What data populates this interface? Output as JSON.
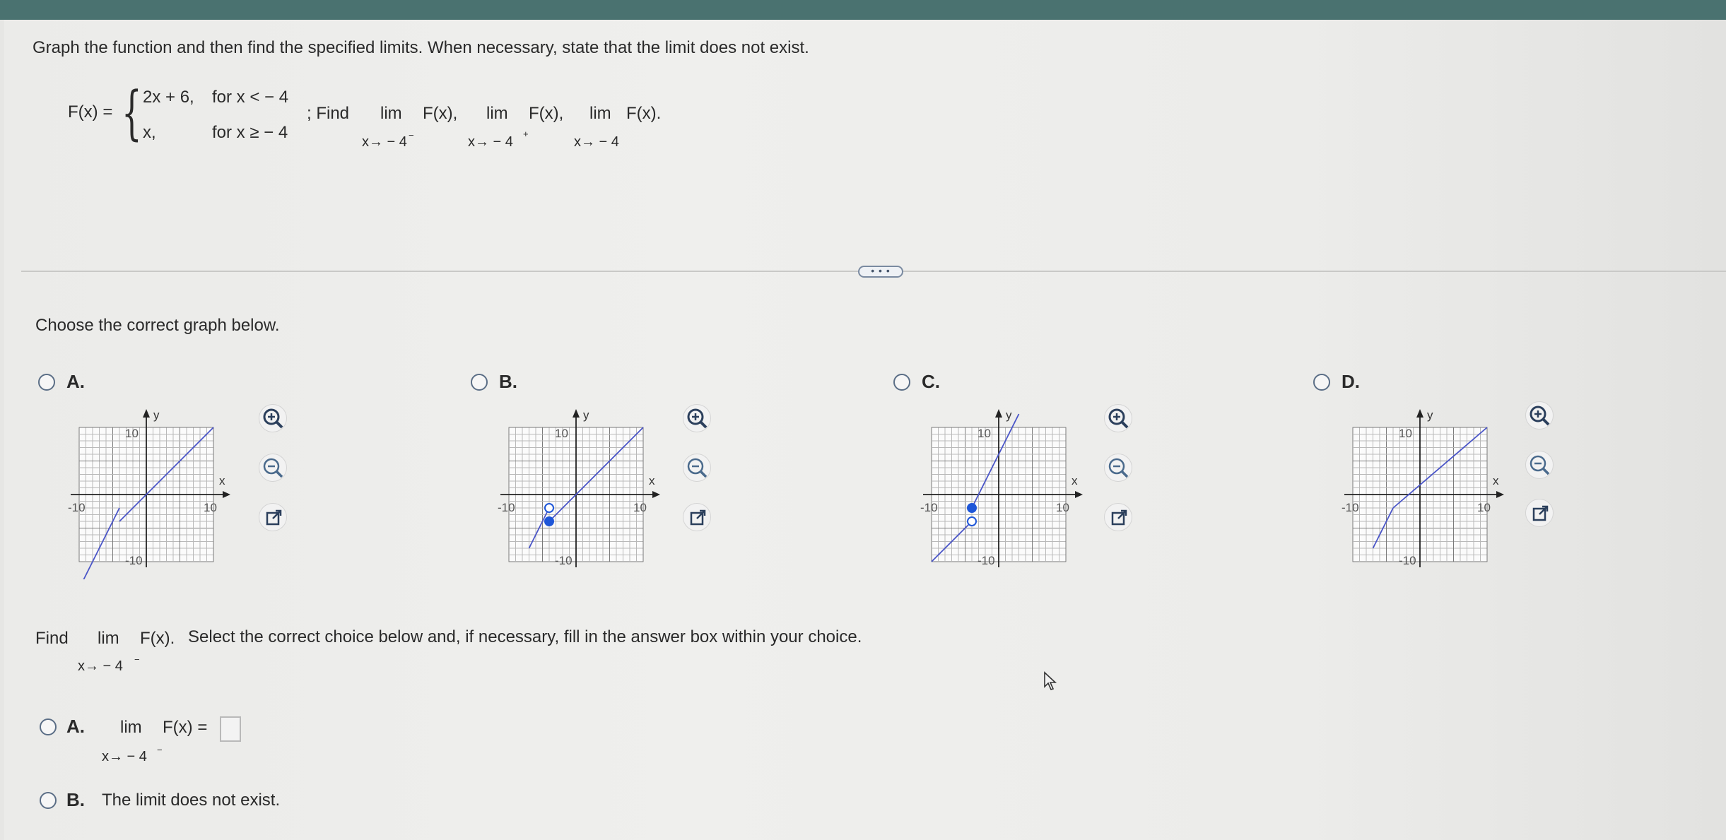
{
  "question": {
    "instruction": "Graph the function and then find the specified limits. When necessary, state that the limit does not exist.",
    "function_name": "F(x) =",
    "piece1_expr": "2x + 6,",
    "piece1_cond": "for x < − 4",
    "piece2_expr": "x,",
    "piece2_cond": "for x ≥ − 4",
    "find_label": "; Find",
    "lim_word": "lim",
    "limits": [
      {
        "expr": "F(x),",
        "sub": "x→ − 4",
        "sup": "−"
      },
      {
        "expr": "F(x),",
        "sub": "x→ − 4",
        "sup": "+"
      },
      {
        "expr": "F(x).",
        "sub": "x→ − 4",
        "sup": ""
      }
    ]
  },
  "more_button": "• • •",
  "graph_prompt": "Choose the correct graph below.",
  "graph_choices": [
    {
      "letter": "A.",
      "pieces": [
        [
          [
            -10,
            -14
          ],
          [
            -4,
            -2
          ]
        ],
        [
          [
            -4,
            -4
          ],
          [
            10,
            10
          ]
        ]
      ],
      "dots": []
    },
    {
      "letter": "B.",
      "pieces": [
        [
          [
            -7,
            -8
          ],
          [
            -4,
            -2
          ]
        ],
        [
          [
            -4,
            -4
          ],
          [
            10,
            10
          ]
        ]
      ],
      "dots": [
        {
          "x": -4,
          "y": -2,
          "filled": false
        },
        {
          "x": -4,
          "y": -4,
          "filled": true
        }
      ]
    },
    {
      "letter": "C.",
      "pieces": [
        [
          [
            -10,
            -10
          ],
          [
            -4,
            -4
          ]
        ],
        [
          [
            -4,
            -2
          ],
          [
            3,
            12
          ]
        ]
      ],
      "dots": [
        {
          "x": -4,
          "y": -2,
          "filled": true
        },
        {
          "x": -4,
          "y": -4,
          "filled": false
        }
      ]
    },
    {
      "letter": "D.",
      "pieces": [
        [
          [
            -7,
            -8
          ],
          [
            -4,
            -2
          ]
        ],
        [
          [
            -4,
            -2
          ],
          [
            10,
            10
          ]
        ]
      ],
      "dots": []
    }
  ],
  "graph_labels": {
    "y": "y",
    "x": "x",
    "max": "10",
    "min": "-10"
  },
  "sub_question": {
    "find": "Find",
    "lim_word": "lim",
    "expr": "F(x).",
    "rest": "Select the correct choice below and, if necessary, fill in the answer box within your choice.",
    "sub": "x→ − 4",
    "sup": "−"
  },
  "answer_choices": {
    "a_letter": "A.",
    "a_lim": "lim",
    "a_expr": "F(x) =",
    "a_sub": "x→ − 4",
    "a_sup": "−",
    "b_letter": "B.",
    "b_text": "The limit does not exist."
  },
  "colors": {
    "graph_line": "#4a55c8",
    "dot": "#1e56d8",
    "radio_border": "#5b6e86",
    "top_bar": "#4a7270"
  },
  "icons": [
    "zoom-in-icon",
    "zoom-out-icon",
    "popout-icon",
    "cursor-icon"
  ]
}
